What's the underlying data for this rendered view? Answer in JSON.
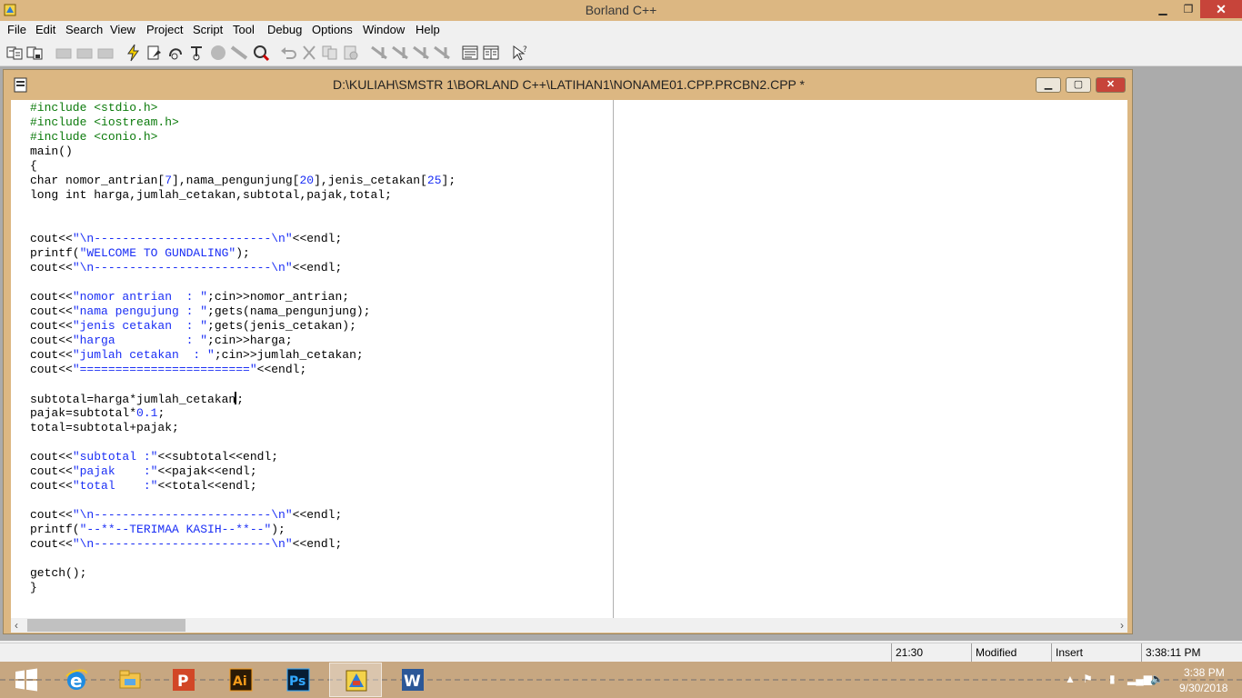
{
  "window": {
    "title": "Borland C++",
    "min": "▁",
    "restore": "❐",
    "close": "✕"
  },
  "menu": [
    "File",
    "Edit",
    "Search",
    "View",
    "Project",
    "Script",
    "Tool",
    "Debug",
    "Options",
    "Window",
    "Help"
  ],
  "toolbar": [
    "open-project-icon",
    "save-project-icon",
    "build-icon-disabled-1",
    "build-icon-disabled-2",
    "build-icon-disabled-3",
    "run-icon",
    "make-icon",
    "step-over-icon",
    "trace-into-icon",
    "stop-icon",
    "toggle-breakpoint-icon",
    "inspect-icon",
    "undo-icon",
    "cut-icon",
    "copy-icon",
    "paste-icon",
    "search-icon-1",
    "search-icon-2",
    "search-icon-3",
    "search-icon-4",
    "message-window-icon",
    "project-window-icon",
    "help-icon"
  ],
  "editor": {
    "title": "D:\\KULIAH\\SMSTR 1\\BORLAND C++\\LATIHAN1\\NONAME01.CPP.PRCBN2.CPP *",
    "lines": [
      "#include <stdio.h>",
      "#include <iostream.h>",
      "#include <conio.h>",
      "main()",
      "{",
      "char nomor_antrian[7],nama_pengunjung[20],jenis_cetakan[25];",
      "long int harga,jumlah_cetakan,subtotal,pajak,total;",
      "",
      "",
      "cout<<\"\\n-------------------------\\n\"<<endl;",
      "printf(\"WELCOME TO GUNDALING\");",
      "cout<<\"\\n-------------------------\\n\"<<endl;",
      "",
      "cout<<\"nomor antrian  : \";cin>>nomor_antrian;",
      "cout<<\"nama pengujung : \";gets(nama_pengunjung);",
      "cout<<\"jenis cetakan  : \";gets(jenis_cetakan);",
      "cout<<\"harga          : \";cin>>harga;",
      "cout<<\"jumlah cetakan  : \";cin>>jumlah_cetakan;",
      "cout<<\"========================\"<<endl;",
      "",
      "subtotal=harga*jumlah_cetakan;",
      "pajak=subtotal*0.1;",
      "total=subtotal+pajak;",
      "",
      "cout<<\"subtotal :\"<<subtotal<<endl;",
      "cout<<\"pajak    :\"<<pajak<<endl;",
      "cout<<\"total    :\"<<total<<endl;",
      "",
      "cout<<\"\\n-------------------------\\n\"<<endl;",
      "printf(\"--**--TERIMAA KASIH--**--\");",
      "cout<<\"\\n-------------------------\\n\"<<endl;",
      "",
      "getch();",
      "}"
    ],
    "cursor": {
      "line": 21,
      "col": 30
    }
  },
  "status": {
    "position": "21:30",
    "modified": "Modified",
    "mode": "Insert",
    "time": "3:38:11 PM"
  },
  "taskbar": {
    "apps": [
      "start-icon",
      "internet-explorer-icon",
      "file-explorer-icon",
      "powerpoint-icon",
      "illustrator-icon",
      "photoshop-icon",
      "borland-cpp-icon",
      "word-icon"
    ],
    "active_app": "borland-cpp-icon",
    "ai_label": "Ai",
    "ps_label": "Ps",
    "w_label": "W",
    "p_label": "P",
    "clock_time": "3:38 PM",
    "clock_date": "9/30/2018"
  },
  "colors": {
    "title_bg": "#dcb782",
    "preprocessor": "#0b7a0b",
    "string": "#1a2ef5",
    "close_button": "#c7443a"
  }
}
